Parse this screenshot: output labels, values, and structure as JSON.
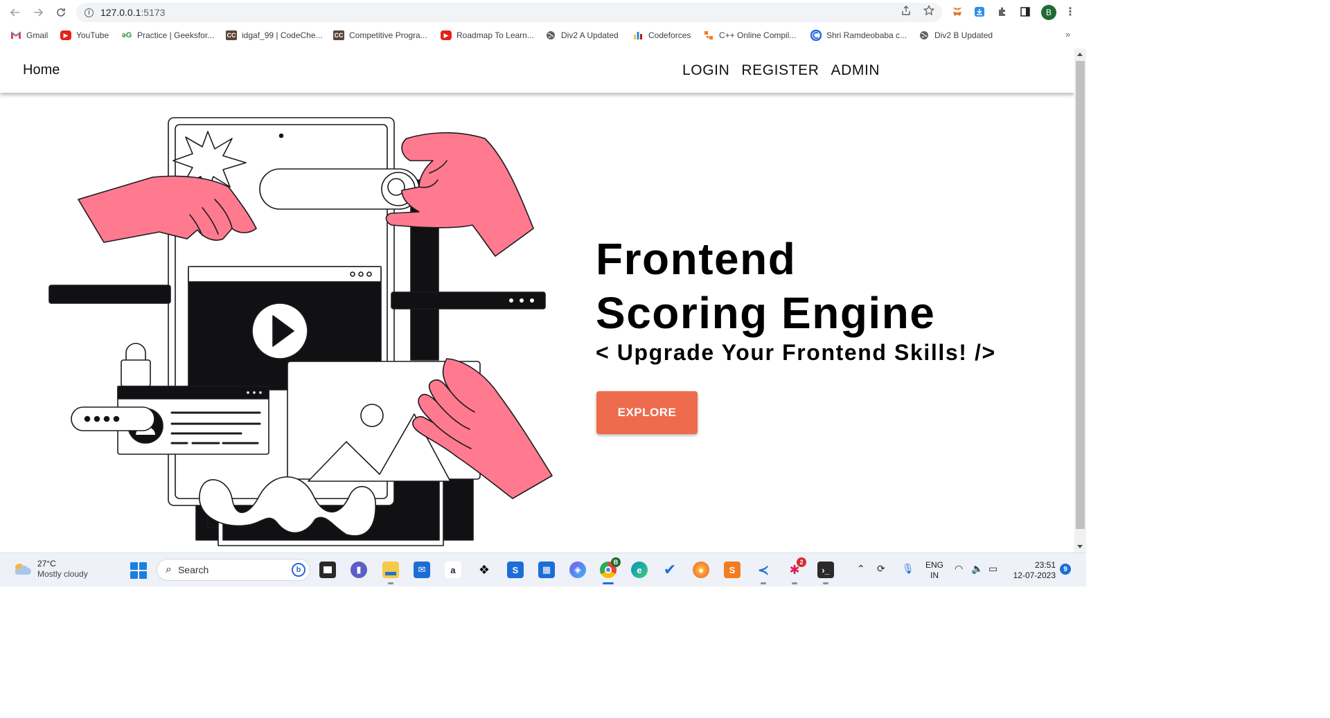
{
  "browser": {
    "url_host": "127.0.0.1",
    "url_port": ":5173",
    "profile_initial": "B",
    "bookmarks": [
      {
        "label": "Gmail",
        "icon": "gmail-icon"
      },
      {
        "label": "YouTube",
        "icon": "youtube-icon"
      },
      {
        "label": "Practice | Geeksfor...",
        "icon": "geeksforgeeks-icon"
      },
      {
        "label": "idgaf_99 | CodeChe...",
        "icon": "codechef-icon"
      },
      {
        "label": "Competitive Progra...",
        "icon": "codechef-icon"
      },
      {
        "label": "Roadmap To Learn...",
        "icon": "youtube-icon"
      },
      {
        "label": "Div2 A Updated",
        "icon": "globe-icon"
      },
      {
        "label": "Codeforces",
        "icon": "codeforces-icon"
      },
      {
        "label": "C++ Online Compil...",
        "icon": "compiler-icon"
      },
      {
        "label": "Shri Ramdeobaba c...",
        "icon": "college-icon"
      },
      {
        "label": "Div2 B Updated",
        "icon": "globe-icon"
      }
    ],
    "bookmarks_more": "»"
  },
  "site": {
    "nav_home": "Home",
    "nav_links": [
      "LOGIN",
      "REGISTER",
      "ADMIN"
    ],
    "hero_title_line1": "Frontend",
    "hero_title_line2": "Scoring Engine",
    "hero_subtitle": "< Upgrade Your Frontend Skills! />",
    "cta_label": "EXPLORE",
    "colors": {
      "accent": "#ee6b4d",
      "illustration_pink": "#ff7a8f",
      "ink": "#111114"
    }
  },
  "taskbar": {
    "weather_temp": "27°C",
    "weather_condition": "Mostly cloudy",
    "search_placeholder": "Search",
    "chrome_badge": "B",
    "slack_badge": "2",
    "language_line1": "ENG",
    "language_line2": "IN",
    "time": "23:51",
    "date": "12-07-2023",
    "notification_count": "9"
  }
}
